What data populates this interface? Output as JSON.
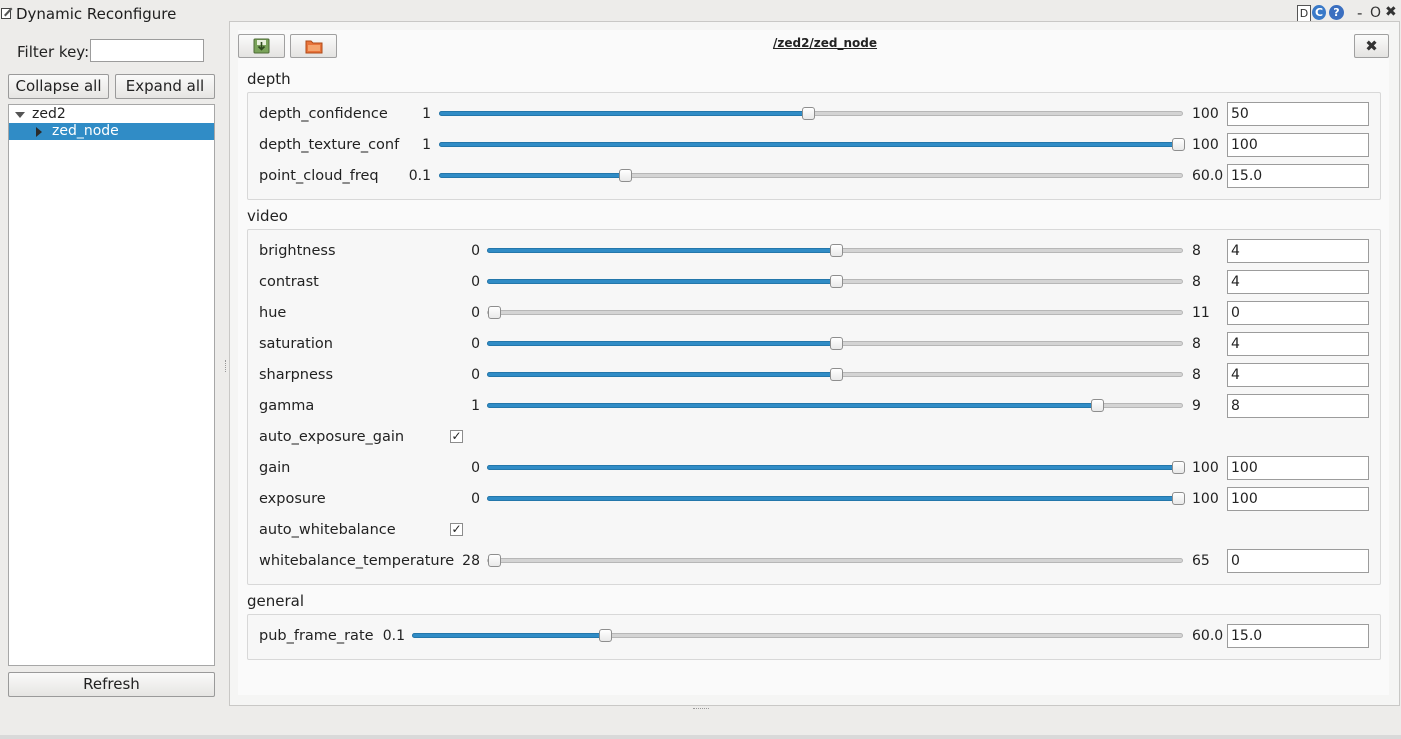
{
  "window": {
    "title": "Dynamic Reconfigure",
    "title_buttons": [
      "D",
      "C",
      "?",
      "-",
      "O",
      "✖"
    ]
  },
  "left": {
    "filter_label": "Filter key:",
    "filter_value": "",
    "collapse_all": "Collapse all",
    "expand_all": "Expand all",
    "tree": [
      "zed2",
      "zed_node"
    ],
    "refresh": "Refresh"
  },
  "node": {
    "title": "/zed2/zed_node",
    "close": "✖"
  },
  "groups": [
    {
      "title": "depth",
      "params": [
        {
          "name": "depth_confidence",
          "type": "slider",
          "min": "1",
          "max": "100",
          "value": "50",
          "fraction": 0.495
        },
        {
          "name": "depth_texture_conf",
          "type": "slider",
          "min": "1",
          "max": "100",
          "value": "100",
          "fraction": 1.0
        },
        {
          "name": "point_cloud_freq",
          "type": "slider",
          "min": "0.1",
          "max": "60.0",
          "value": "15.0",
          "fraction": 0.249
        }
      ]
    },
    {
      "title": "video",
      "params": [
        {
          "name": "brightness",
          "type": "slider",
          "min": "0",
          "max": "8",
          "value": "4",
          "fraction": 0.5
        },
        {
          "name": "contrast",
          "type": "slider",
          "min": "0",
          "max": "8",
          "value": "4",
          "fraction": 0.5
        },
        {
          "name": "hue",
          "type": "slider",
          "min": "0",
          "max": "11",
          "value": "0",
          "fraction": 0.0
        },
        {
          "name": "saturation",
          "type": "slider",
          "min": "0",
          "max": "8",
          "value": "4",
          "fraction": 0.5
        },
        {
          "name": "sharpness",
          "type": "slider",
          "min": "0",
          "max": "8",
          "value": "4",
          "fraction": 0.5
        },
        {
          "name": "gamma",
          "type": "slider",
          "min": "1",
          "max": "9",
          "value": "8",
          "fraction": 0.875
        },
        {
          "name": "auto_exposure_gain",
          "type": "check",
          "checked": true
        },
        {
          "name": "gain",
          "type": "slider",
          "min": "0",
          "max": "100",
          "value": "100",
          "fraction": 1.0
        },
        {
          "name": "exposure",
          "type": "slider",
          "min": "0",
          "max": "100",
          "value": "100",
          "fraction": 1.0
        },
        {
          "name": "auto_whitebalance",
          "type": "check",
          "checked": true
        },
        {
          "name": "whitebalance_temperature",
          "type": "slider",
          "min": "28",
          "max": "65",
          "value": "0",
          "fraction": 0.0
        }
      ]
    },
    {
      "title": "general",
      "params": [
        {
          "name": "pub_frame_rate",
          "type": "slider",
          "min": "0.1",
          "max": "60.0",
          "value": "15.0",
          "fraction": 0.249
        }
      ]
    }
  ],
  "colors": {
    "accent": "#308cc6",
    "background": "#edecea"
  }
}
